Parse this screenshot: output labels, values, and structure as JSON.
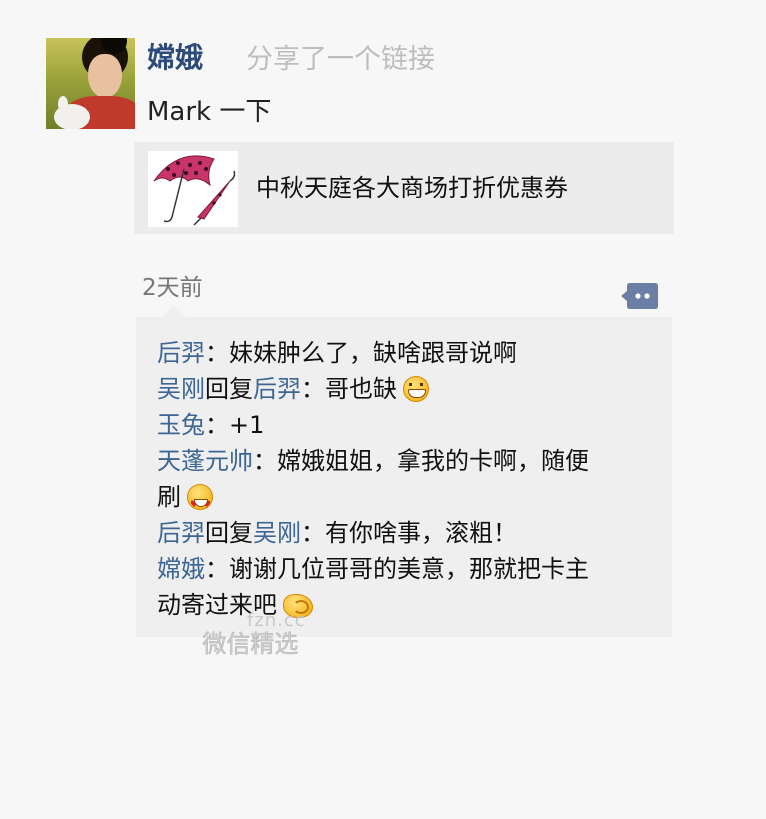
{
  "post": {
    "author": "嫦娥",
    "action": "分享了一个链接",
    "message": "Mark 一下",
    "link": {
      "title": "中秋天庭各大商场打折优惠券",
      "thumbnail_icon": "umbrella-icon"
    },
    "time": "2天前"
  },
  "comments": [
    {
      "user": "后羿",
      "sep": "：",
      "text": "妹妹肿么了，缺啥跟哥说啊"
    },
    {
      "user": "吴刚",
      "reply_word": "回复",
      "reply_to": "后羿",
      "sep": "：",
      "text": "哥也缺",
      "emoji": "grin-emoji"
    },
    {
      "user": "玉兔",
      "sep": "：",
      "text": "+1"
    },
    {
      "user": "天蓬元帅",
      "sep": "：",
      "text": "嫦娥姐姐，拿我的卡啊，随便",
      "text2": "刷",
      "emoji": "heart-eyes-emoji"
    },
    {
      "user": "后羿",
      "reply_word": "回复",
      "reply_to": "吴刚",
      "sep": "：",
      "text": "有你啥事，滚粗！"
    },
    {
      "user": "嫦娥",
      "sep": "：",
      "text": "谢谢几位哥哥的美意，那就把卡主",
      "text2": "动寄过来吧",
      "emoji": "hand-emoji"
    }
  ],
  "watermark": {
    "domain": "fzn.cc",
    "text": "微信精选"
  },
  "colors": {
    "author": "#2c4a7a",
    "user_link": "#3d6696",
    "background": "#f7f7f7",
    "card": "#ececec"
  }
}
